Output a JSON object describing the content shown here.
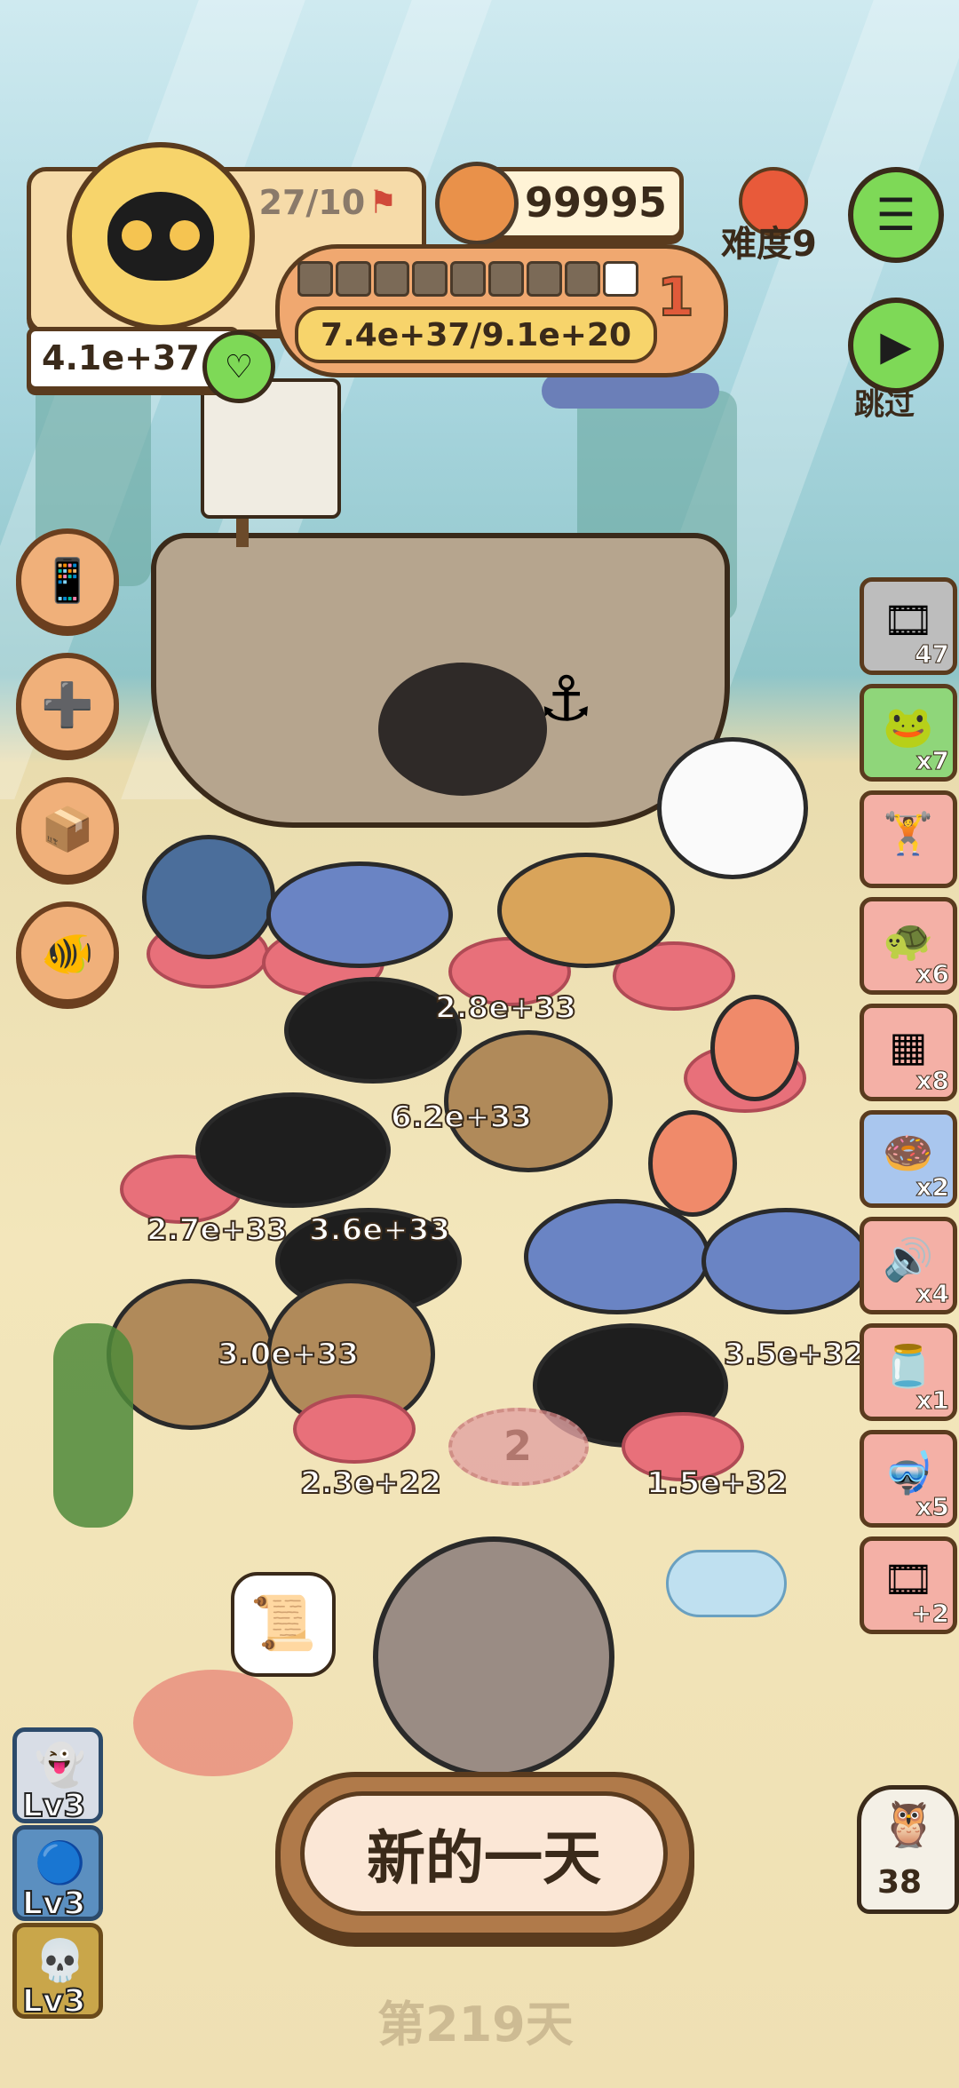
{
  "hud": {
    "flag_count": "27/10",
    "coins": "99995",
    "difficulty": "难度9",
    "level_badge": "1",
    "progress": "7.4e+37/9.1e+20",
    "progress_fill": 0.9,
    "power": "4.1e+37",
    "skip_label": "跳过"
  },
  "side_items": [
    {
      "icon": "film-roll-icon",
      "count": "47"
    },
    {
      "icon": "frog-icon",
      "count": "x7"
    },
    {
      "icon": "gym-rack-icon",
      "count": ""
    },
    {
      "icon": "turtle-shell-icon",
      "count": "x6"
    },
    {
      "icon": "ice-tray-icon",
      "count": "x8"
    },
    {
      "icon": "donut-icon",
      "count": "x2"
    },
    {
      "icon": "speaker-icon",
      "count": "x4"
    },
    {
      "icon": "jar-icon",
      "count": "x1"
    },
    {
      "icon": "snorkel-icon",
      "count": "x5"
    },
    {
      "icon": "film-plus-icon",
      "count": "+2"
    }
  ],
  "animals": [
    {
      "label": "2.8e+33"
    },
    {
      "label": "6.2e+33"
    },
    {
      "label": "2.7e+33"
    },
    {
      "label": "3.6e+33"
    },
    {
      "label": "3.0e+33"
    },
    {
      "label": "3.5e+32"
    },
    {
      "label": "2.3e+22"
    },
    {
      "label": "1.5e+32"
    }
  ],
  "empty_slot": "2",
  "levels": [
    "Lv3",
    "Lv3",
    "Lv3"
  ],
  "owl_count": "38",
  "new_day_button": "新的一天",
  "day_label": "第219天"
}
